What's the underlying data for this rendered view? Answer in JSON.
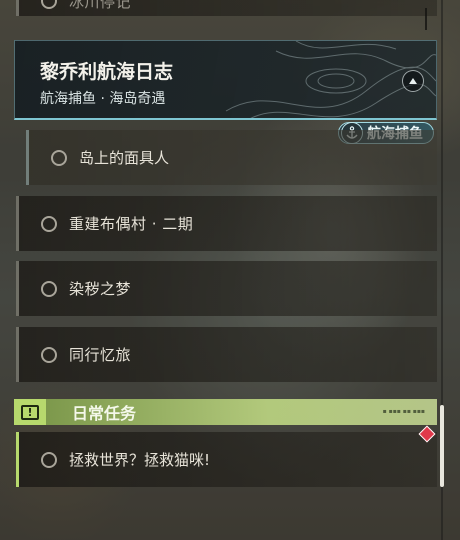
{
  "quest_list": {
    "top_partial_label": "冰川停记",
    "header": {
      "title": "黎乔利航海日志",
      "subtitle": "航海捕鱼 · 海岛奇遇"
    },
    "badge_label": "航海捕鱼",
    "sub_quest_label": "岛上的面具人",
    "quests": [
      "重建布偶村 · 二期",
      "染秽之梦",
      "同行忆旅"
    ],
    "daily_section": {
      "label": "日常任务",
      "icon": "!"
    },
    "daily_quest_label": "拯救世界？拯救猫咪!"
  },
  "colors": {
    "accent_teal": "#7fc6d2",
    "daily_green": "#b7d96d",
    "marker_red": "#e0384a"
  },
  "icons": [
    "quest-ring-icon",
    "collapse-arrow-icon",
    "anchor-icon",
    "alert-icon",
    "diamond-marker-icon"
  ]
}
